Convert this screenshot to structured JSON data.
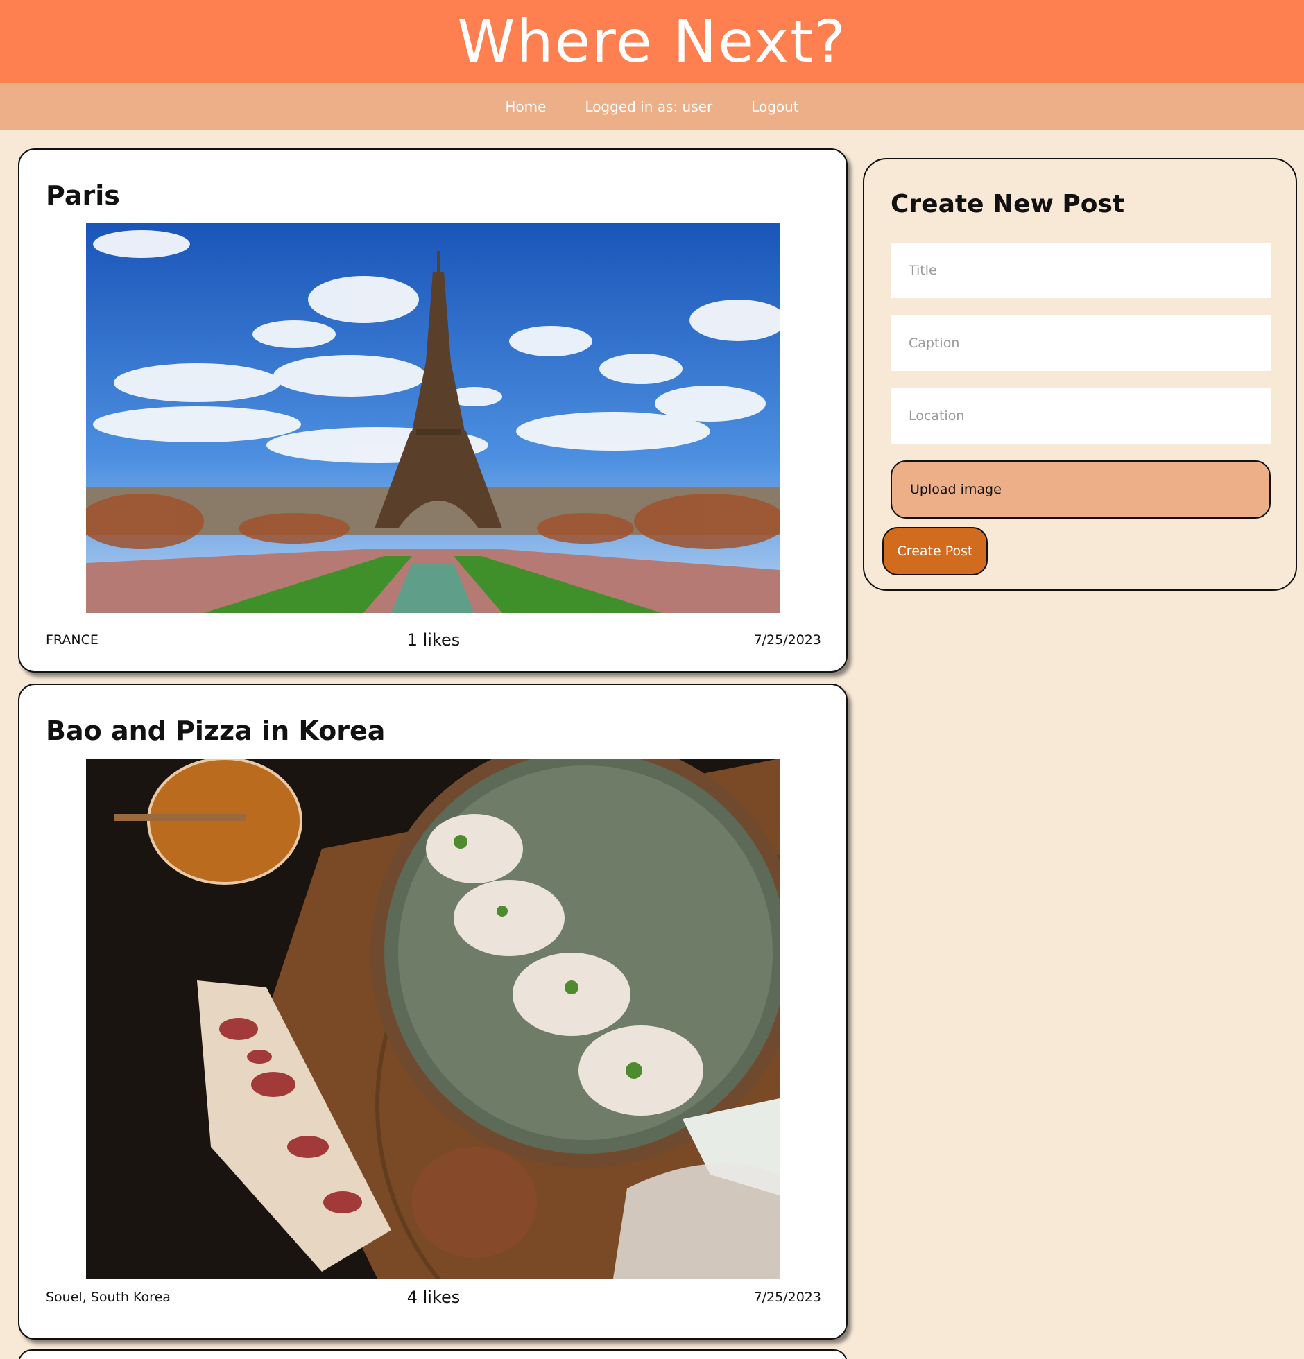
{
  "header": {
    "title": "Where Next?"
  },
  "nav": {
    "home": "Home",
    "status": "Logged in as: user",
    "logout": "Logout"
  },
  "posts": [
    {
      "title": "Paris",
      "image_icon": "eiffel-tower-photo",
      "location": "FRANCE",
      "likes": "1 likes",
      "date": "7/25/2023"
    },
    {
      "title": "Bao and Pizza in Korea",
      "image_icon": "bao-and-pizza-photo",
      "location": "Souel, South Korea",
      "likes": "4 likes",
      "date": "7/25/2023"
    }
  ],
  "create": {
    "heading": "Create New Post",
    "title_placeholder": "Title",
    "caption_placeholder": "Caption",
    "location_placeholder": "Location",
    "upload_label": "Upload image",
    "submit_label": "Create Post"
  },
  "colors": {
    "header_bg": "#fe7f4f",
    "nav_bg": "#ecaf87",
    "page_bg": "#f8e9d7",
    "button_bg": "#d16b1e"
  }
}
